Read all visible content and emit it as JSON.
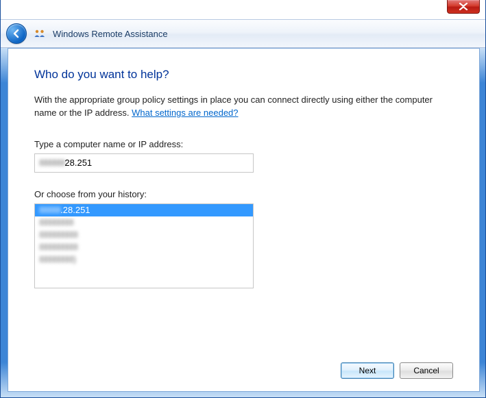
{
  "header": {
    "title": "Windows Remote Assistance"
  },
  "page": {
    "title": "Who do you want to help?",
    "description_lead": "With the appropriate group policy settings in place you can connect directly using either the computer name or the IP address. ",
    "link_text": "What settings are needed?"
  },
  "fields": {
    "address_label": "Type a computer name or IP address:",
    "address_value_suffix": "28.251",
    "history_label": "Or choose from your history:",
    "history_items": [
      {
        "visible_suffix": ".28.251",
        "selected": true,
        "obscured_prefix": true
      },
      {
        "obscured": true
      },
      {
        "obscured": true
      },
      {
        "obscured": true
      },
      {
        "obscured": true
      }
    ]
  },
  "buttons": {
    "next": "Next",
    "cancel": "Cancel"
  }
}
